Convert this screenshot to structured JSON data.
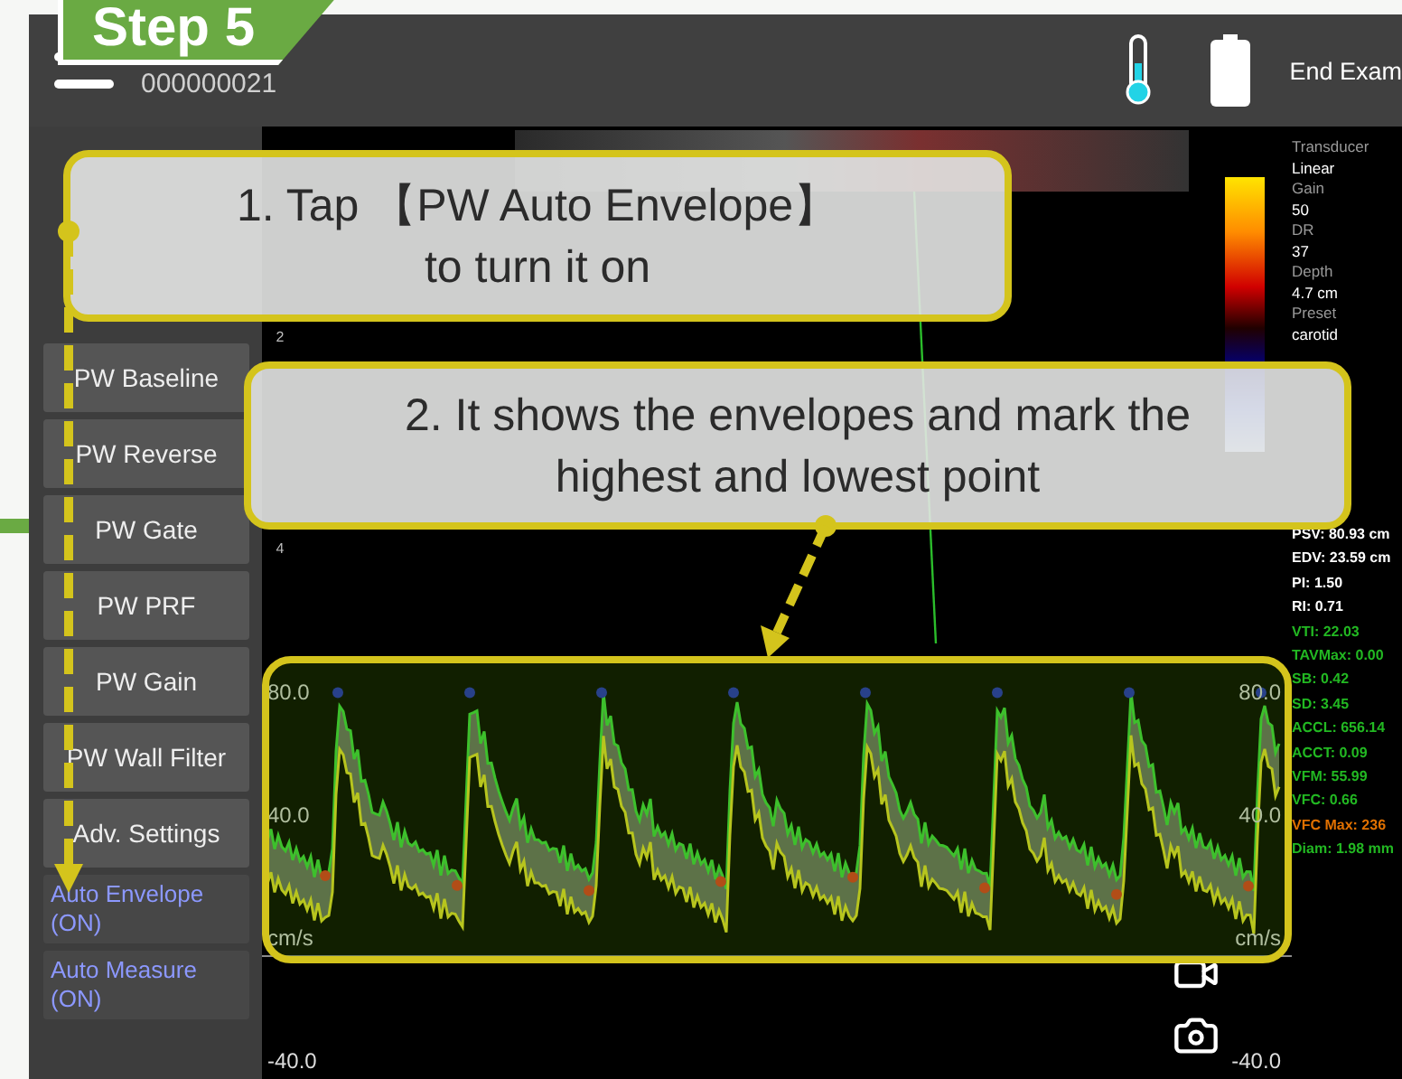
{
  "step_badge": "Step 5",
  "header": {
    "case_id": "000000021",
    "end_button": "End Exam"
  },
  "sidebar": {
    "items": [
      {
        "kind": "button",
        "label": "PW Baseline"
      },
      {
        "kind": "button",
        "label": "PW Reverse"
      },
      {
        "kind": "button",
        "label": "PW Gate"
      },
      {
        "kind": "button",
        "label": "PW PRF"
      },
      {
        "kind": "button",
        "label": "PW Gain"
      },
      {
        "kind": "button",
        "label": "PW Wall Filter"
      },
      {
        "kind": "button",
        "label": "Adv. Settings"
      },
      {
        "kind": "toggle",
        "label": "Auto Envelope (ON)",
        "on": true
      },
      {
        "kind": "toggle",
        "label": "Auto Measure (ON)",
        "on": true
      }
    ]
  },
  "image": {
    "depth_marks": [
      "2",
      "4"
    ]
  },
  "doppler": {
    "left_labels": [
      "80.0",
      "40.0",
      "cm/s",
      "-40.0"
    ],
    "right_labels": [
      "80.0",
      "40.0",
      "cm/s",
      "-40.0"
    ]
  },
  "params": [
    {
      "label": "Transducer",
      "value": "Linear"
    },
    {
      "label": "Gain",
      "value": "50"
    },
    {
      "label": "DR",
      "value": "37"
    },
    {
      "label": "Depth",
      "value": "4.7 cm"
    },
    {
      "label": "Preset",
      "value": "carotid"
    }
  ],
  "measurements": [
    {
      "text": "PSV: 80.93 cm",
      "color": "#ffffff"
    },
    {
      "text": "EDV: 23.59 cm",
      "color": "#ffffff"
    },
    {
      "text": "PI: 1.50",
      "color": "#ffffff"
    },
    {
      "text": "RI: 0.71",
      "color": "#ffffff"
    },
    {
      "text": "VTI: 22.03",
      "color": "#22b822"
    },
    {
      "text": "TAVMax: 0.00",
      "color": "#22b822"
    },
    {
      "text": "SB: 0.42",
      "color": "#22b822"
    },
    {
      "text": "SD: 3.45",
      "color": "#22b822"
    },
    {
      "text": "ACCL: 656.14",
      "color": "#22b822"
    },
    {
      "text": "ACCT: 0.09",
      "color": "#22b822"
    },
    {
      "text": "VFM: 55.99",
      "color": "#22b822"
    },
    {
      "text": "VFC: 0.66",
      "color": "#22b822"
    },
    {
      "text": "VFC Max: 236",
      "color": "#e07000"
    },
    {
      "text": "Diam: 1.98 mm",
      "color": "#22b822"
    }
  ],
  "callouts": [
    {
      "text": "1. Tap 【PW Auto Envelope】\nto turn it on"
    },
    {
      "text": "2. It shows the envelopes and mark the\nhighest and lowest point"
    }
  ]
}
